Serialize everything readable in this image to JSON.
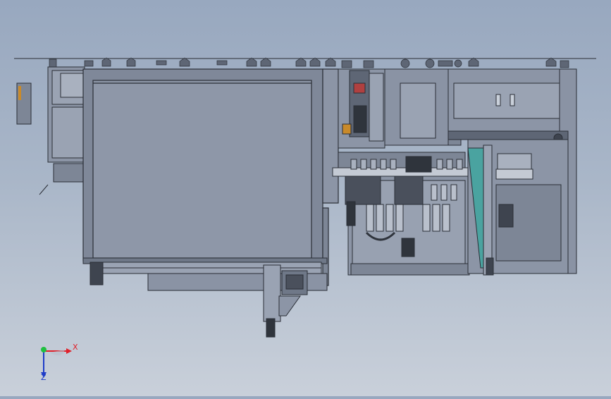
{
  "scene": {
    "background_top": "#98a8bf",
    "background_bottom": "#c9d0da",
    "machine_fill": "#8c95a6",
    "machine_dark": "#5e6675",
    "edge_color": "#2a2e36",
    "accent_red": "#b04040",
    "accent_teal": "#4aa3a0"
  },
  "triad": {
    "x_label": "X",
    "z_label": "Z",
    "x_color": "#e0202a",
    "y_color": "#20c040",
    "z_color": "#1e3cc8"
  }
}
